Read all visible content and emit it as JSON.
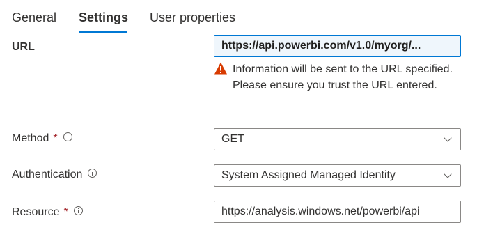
{
  "tabs": [
    {
      "label": "General"
    },
    {
      "label": "Settings"
    },
    {
      "label": "User properties"
    }
  ],
  "active_tab": "Settings",
  "form": {
    "url": {
      "label": "URL",
      "value": "https://api.powerbi.com/v1.0/myorg/..."
    },
    "warning": {
      "icon": "warning-icon",
      "text": "Information will be sent to the URL specified. Please ensure you trust the URL entered."
    },
    "method": {
      "label": "Method",
      "required_mark": "*",
      "value": "GET"
    },
    "authentication": {
      "label": "Authentication",
      "value": "System Assigned Managed Identity"
    },
    "resource": {
      "label": "Resource",
      "required_mark": "*",
      "value": "https://analysis.windows.net/powerbi/api"
    }
  },
  "colors": {
    "accent": "#0078d4",
    "required": "#a4262c",
    "warning": "#d83b01"
  }
}
